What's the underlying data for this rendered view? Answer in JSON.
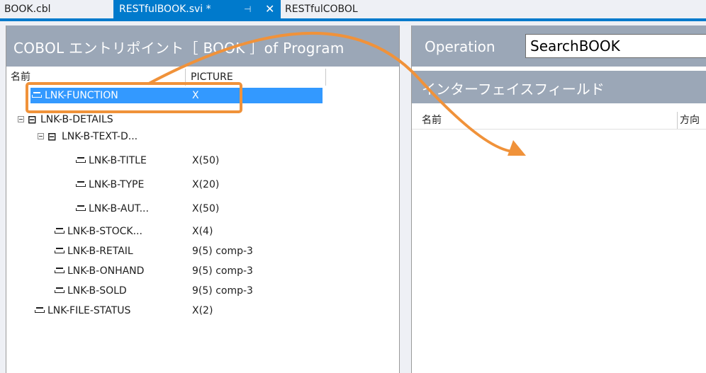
{
  "tabs": {
    "book": "BOOK.cbl",
    "active": "RESTfulBOOK.svi *",
    "pin": "⊣",
    "close": "✕",
    "rest": "RESTfulCOBOL"
  },
  "left": {
    "title": "COBOL エントリポイント［ BOOK ］of Program",
    "col_name": "名前",
    "col_picture": "PICTURE",
    "rows": [
      {
        "label": "LNK-FUNCTION",
        "pic": "X"
      },
      {
        "label": "LNK-B-DETAILS",
        "pic": ""
      },
      {
        "label": "LNK-B-TEXT-D...",
        "pic": ""
      },
      {
        "label": "LNK-B-TITLE",
        "pic": "X(50)"
      },
      {
        "label": "LNK-B-TYPE",
        "pic": "X(20)"
      },
      {
        "label": "LNK-B-AUT...",
        "pic": "X(50)"
      },
      {
        "label": "LNK-B-STOCK...",
        "pic": "X(4)"
      },
      {
        "label": "LNK-B-RETAIL",
        "pic": "9(5) comp-3"
      },
      {
        "label": "LNK-B-ONHAND",
        "pic": "9(5) comp-3"
      },
      {
        "label": "LNK-B-SOLD",
        "pic": "9(5) comp-3"
      },
      {
        "label": "LNK-FILE-STATUS",
        "pic": "X(2)"
      }
    ]
  },
  "right": {
    "operation_label": "Operation",
    "operation_value": "SearchBOOK",
    "interface_title": "インターフェイスフィールド",
    "col_name": "名前",
    "col_dir": "方向"
  },
  "colors": {
    "tab_accent": "#007acc",
    "header_bg": "#9ba7b7",
    "selection": "#3399ff",
    "annotation": "#f0923a"
  }
}
